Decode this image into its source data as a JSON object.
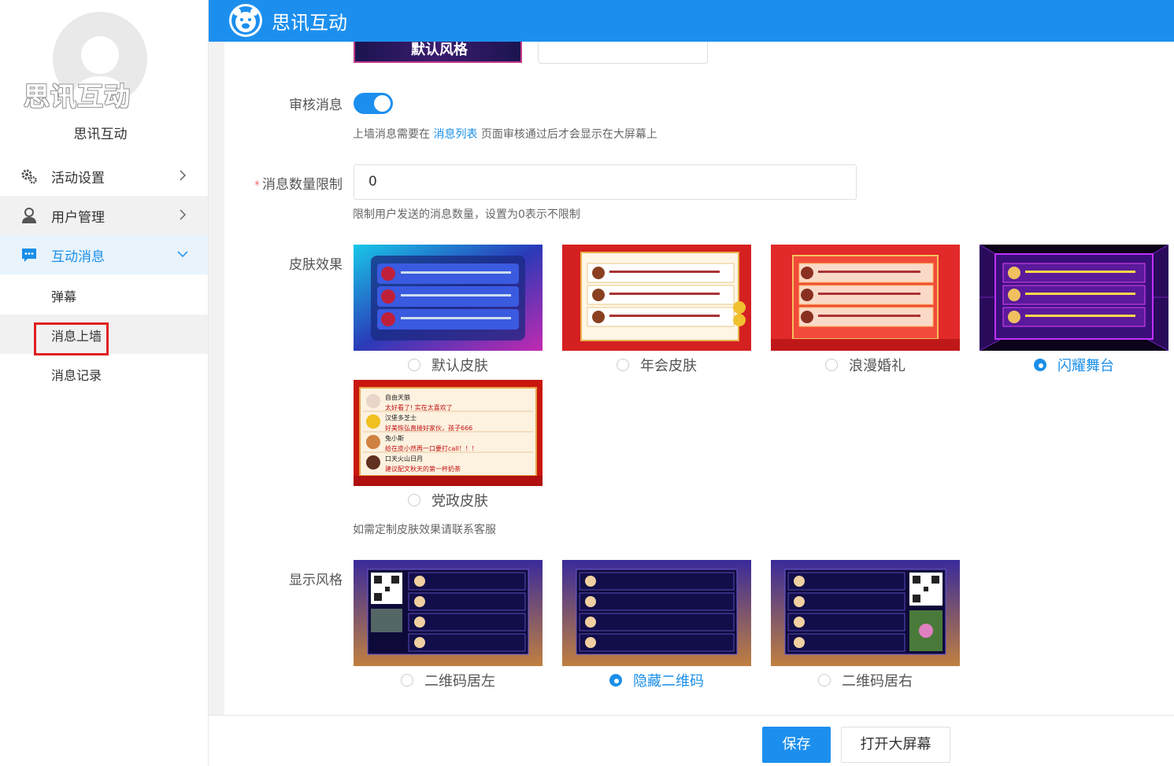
{
  "app": {
    "title": "思讯互动",
    "brand_color": "#1c8fee"
  },
  "sidebar": {
    "avatar_watermark": "思讯互动",
    "name": "思讯互动",
    "menu": [
      {
        "label": "活动设置",
        "icon": "gear-icon",
        "expanded": false
      },
      {
        "label": "用户管理",
        "icon": "user-icon",
        "expanded": false
      },
      {
        "label": "互动消息",
        "icon": "chat-icon",
        "expanded": true
      }
    ],
    "submenu": [
      {
        "label": "弹幕"
      },
      {
        "label": "消息上墙",
        "highlighted": true
      },
      {
        "label": "消息记录"
      }
    ]
  },
  "form": {
    "top_partial_thumb_label": "默认风格",
    "review": {
      "label": "审核消息",
      "enabled": true,
      "hint_before": "上墙消息需要在",
      "hint_link": "消息列表",
      "hint_after": "页面审核通过后才会显示在大屏幕上"
    },
    "limit": {
      "label": "消息数量限制",
      "required_mark": "*",
      "value": "0",
      "hint": "限制用户发送的消息数量，设置为0表示不限制"
    },
    "skin": {
      "label": "皮肤效果",
      "options": [
        {
          "label": "默认皮肤",
          "selected": false
        },
        {
          "label": "年会皮肤",
          "selected": false
        },
        {
          "label": "浪漫婚礼",
          "selected": false
        },
        {
          "label": "闪耀舞台",
          "selected": true
        },
        {
          "label": "党政皮肤",
          "selected": false
        }
      ],
      "party_preview": [
        {
          "name": "自由天狼",
          "msg": "太好看了! 实在太喜欢了"
        },
        {
          "name": "汉堡多芝士",
          "msg": "好美恢弘直接好家伙，孩子666"
        },
        {
          "name": "兔小斯",
          "msg": "给在皮小然再一口要打call！！！"
        },
        {
          "name": "口天火山日月",
          "msg": "建议配文秋天的第一杯奶茶"
        }
      ],
      "hint": "如需定制皮肤效果请联系客服"
    },
    "display": {
      "label": "显示风格",
      "options": [
        {
          "label": "二维码居左",
          "selected": false
        },
        {
          "label": "隐藏二维码",
          "selected": true
        },
        {
          "label": "二维码居右",
          "selected": false
        }
      ]
    }
  },
  "footer": {
    "save_label": "保存",
    "open_screen_label": "打开大屏幕"
  }
}
